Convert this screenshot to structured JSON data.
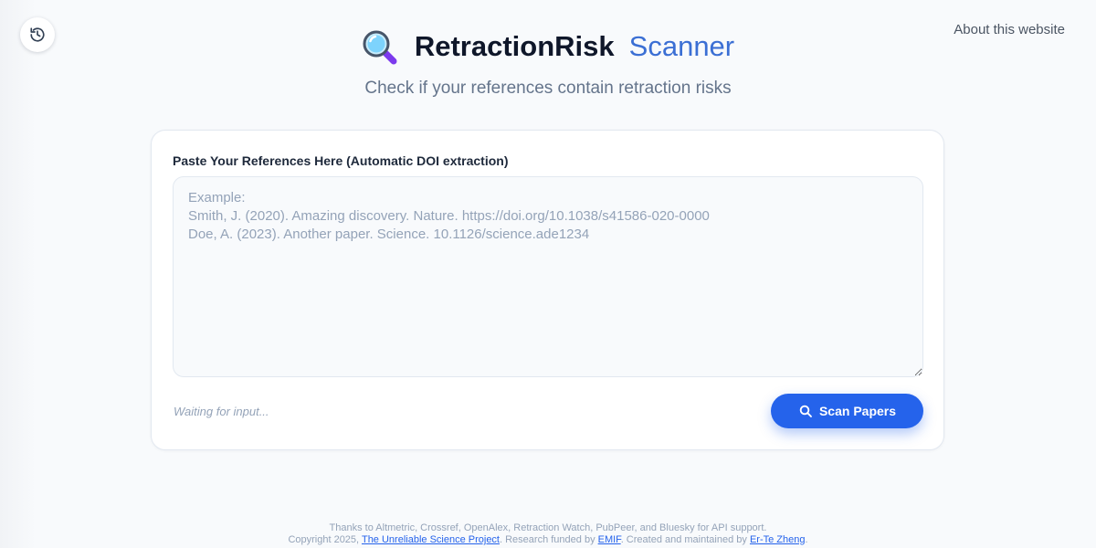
{
  "history_button": {
    "icon": "history-icon"
  },
  "nav": {
    "about_label": "About this website"
  },
  "header": {
    "logo_icon": "magnifying-glass-icon",
    "title_primary": "RetractionRisk",
    "title_accent": "Scanner",
    "subtitle": "Check if your references contain retraction risks"
  },
  "form": {
    "label": "Paste Your References Here (Automatic DOI extraction)",
    "placeholder": "Example:\nSmith, J. (2020). Amazing discovery. Nature. https://doi.org/10.1038/s41586-020-0000\nDoe, A. (2023). Another paper. Science. 10.1126/science.ade1234",
    "value": "",
    "status": "Waiting for input...",
    "scan_button_label": "Scan Papers",
    "scan_button_icon": "search-icon"
  },
  "footer": {
    "line1": "Thanks to Altmetric, Crossref, OpenAlex, Retraction Watch, PubPeer, and Bluesky for API support.",
    "copyright_prefix": "Copyright 2025, ",
    "project_link": "The Unreliable Science Project",
    "funded_prefix": ". Research funded by ",
    "funder_link": "EMIF",
    "created_prefix": ". Created and maintained by ",
    "author_link": "Er-Te Zheng",
    "suffix": "."
  },
  "colors": {
    "accent": "#2563eb",
    "brand_accent": "#3b6fd4",
    "background": "#f8fafc",
    "logo_handle": "#7c3aed",
    "logo_lens": "#38bdf8"
  }
}
